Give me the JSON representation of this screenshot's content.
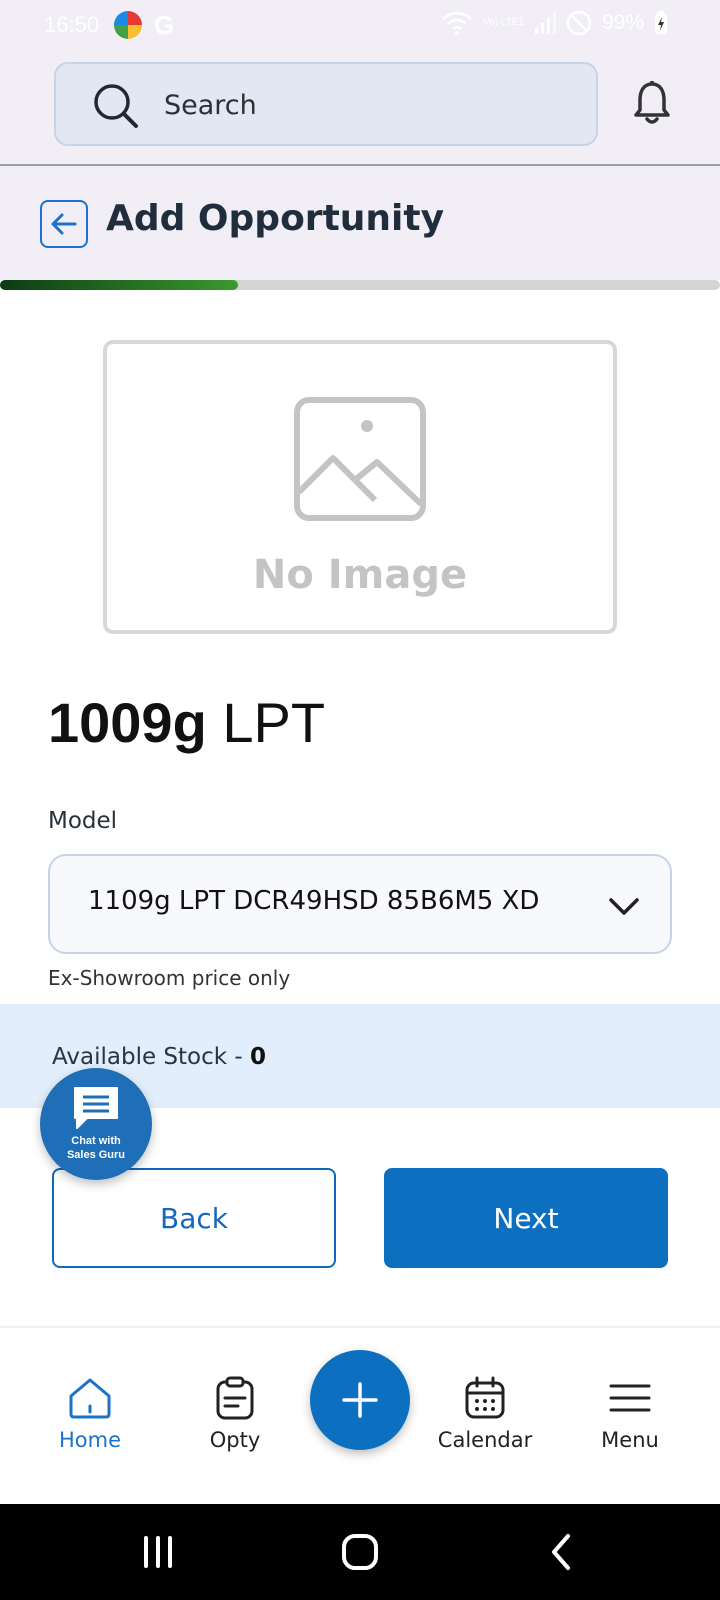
{
  "status_bar": {
    "time": "16:50",
    "network": "Vo) LTE1",
    "battery": "99%"
  },
  "header": {
    "search_placeholder": "Search"
  },
  "page": {
    "title": "Add Opportunity",
    "progress_fraction": 0.33
  },
  "product": {
    "image_placeholder": "No Image",
    "name_bold": "1009g",
    "name_rest": "LPT"
  },
  "model": {
    "label": "Model",
    "selected": "1109g LPT DCR49HSD 85B6M5 XD",
    "price_note": "Ex-Showroom price only"
  },
  "stock": {
    "label": "Available Stock - ",
    "count": "0"
  },
  "chat": {
    "label_line1": "Chat with",
    "label_line2": "Sales Guru"
  },
  "buttons": {
    "back": "Back",
    "next": "Next"
  },
  "bottom_nav": {
    "items": [
      {
        "label": "Home",
        "icon": "home-icon",
        "active": true
      },
      {
        "label": "Opty",
        "icon": "clipboard-icon",
        "active": false
      },
      {
        "label": "Calendar",
        "icon": "calendar-icon",
        "active": false
      },
      {
        "label": "Menu",
        "icon": "hamburger-icon",
        "active": false
      }
    ]
  },
  "colors": {
    "accent": "#0d6fc0",
    "header_bg": "#f1eef6",
    "stock_band": "#e2eefb",
    "progress_start": "#0d3b14",
    "progress_end": "#3a9a2c"
  }
}
